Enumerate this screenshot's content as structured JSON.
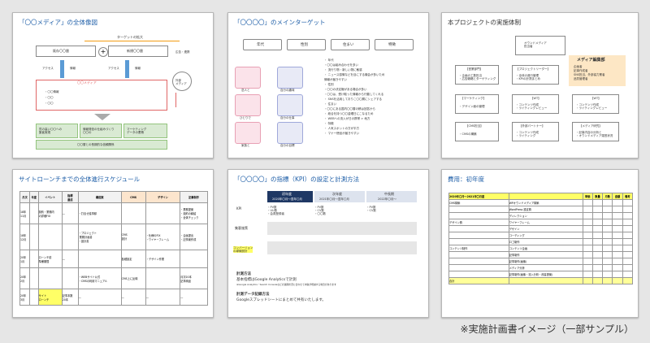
{
  "slides": {
    "s1": {
      "title": "「〇〇メディア」の全体像図",
      "target_expand": "ターゲットの拡大",
      "existing": "既存〇〇層",
      "new": "新規〇〇層",
      "access1": "アクセス",
      "access2": "アクセス",
      "info1": "情報",
      "info2": "情報",
      "ad": "広告・連携",
      "media": "〇〇メディア",
      "outside": "外部\nメディア",
      "bullets": [
        "・〇〇情報",
        "・〇〇",
        "・〇〇"
      ],
      "bottom": [
        "質の高い〇〇への\n集客実現",
        "情報発信の仕組みづくり\n〇〇の",
        "マーケティング\nデータの蓄積"
      ],
      "footer": "〇〇層との長期的な信頼関係"
    },
    "s2": {
      "title": "「〇〇〇〇」のメインターゲット",
      "tags": [
        "年代",
        "性別",
        "住まい",
        "特徴"
      ],
      "people": [
        "恋人と",
        "自分の趣味",
        "ひとりで",
        "自分の仕事",
        "家族と",
        "自分の目標"
      ],
      "notes": [
        "・ 年代",
        "・〇〇は組み合わせを多い",
        "・ 流行り物・新しい物に敏感",
        "・ ニュース感情などを目にする機会が多いため",
        "  情報が届きやすい",
        "・ 性別",
        "・〇〇の決定権がある場合が多い",
        "・〇〇は、受け取った情報から行動してくれる",
        "・ SNSを活用しておりこ〇〇層にシェアする",
        "・ 住まい",
        "・〇〇にある国内〇〇層の積は回答から",
        "・ 総合を持つ〇〇金曜日にこなるため",
        "・ WEBへの流入が日の携帯 > 地方",
        "・ 特徴",
        "・ 人気スポットの方が平方",
        "・ マナー徳品が届きやすい"
      ]
    },
    "s3": {
      "title": "本プロジェクトの実施体制",
      "top": "オウンドメディア\n担当者",
      "team": "メディア編集部",
      "team_items": [
        "企画者",
        "記事作成者",
        "SNS担当、外部協力業者",
        "品質管理者"
      ],
      "row1": [
        "【営業部門】",
        "【プロジェクトリーダー】",
        "【MAI】"
      ],
      "row2": [
        "【マーケティング】",
        "【WT】",
        "【WT】"
      ],
      "row3": [
        "【CMS担当】",
        "【外部パートナー】",
        "【メディア研究】"
      ],
      "row1_sub": [
        "・企画の工数担当\n・広告戦略とターゲティング",
        "・全体の進行管理\n・KPIの計測まとめ",
        "・記事の作成\n・SEOチェック"
      ],
      "row2_sub": [
        "・デザイン面の管理",
        "・コンテンツ作成\n・ライティングレビュー",
        "・コンテンツ作成\n・ライティングレビュー"
      ],
      "row3_sub": [
        "・CMSの構築",
        "・コンテンツ作成\n・ライティング",
        "・記事内容の分析と\n・オウンドメディア運営状況"
      ]
    },
    "s4": {
      "title": "サイトローンチまでの全体進行スケジュール",
      "header": [
        "月次",
        "年度",
        "イベント",
        "指標\n達成",
        "構成案",
        "CMS",
        "デザイン",
        "記事制作"
      ],
      "rows": [
        [
          "18年\n11月",
          "",
          "契約・業務内\nの詳細FIX",
          "—",
          "・打合せ議事録",
          "",
          "",
          "・業務提案\n・契約の締結\n・全体チェック"
        ],
        [
          "18年\n12月",
          "",
          "",
          "",
          "・プロジェクト\n 業務計画書\n・設計書",
          "CMS\n設計",
          "・仕様のFIX\n・ワイヤーフレーム",
          "・企画提出\n・記事案作成"
        ],
        [
          "20年\n1月",
          "",
          "ローンチ前\n準備期間",
          "—",
          "",
          "各種設定",
          "・デザイン作業",
          ""
        ],
        [
          "20年\n2月",
          "",
          "",
          "",
          "・WEBサイト公式\n・CMSの利用マニュアル",
          "CMS上に反映",
          "",
          "月次20本\n記事納品"
        ],
        [
          "20年\n3月",
          "",
          "サイト\nローンチ",
          "記事本数\n20本",
          "—",
          "—",
          "—",
          "—"
        ]
      ]
    },
    "s5": {
      "title": "「〇〇〇〇」の指標（KPI）の設定と計測方法",
      "phases": [
        "初年度",
        "次年度",
        "中長期"
      ],
      "phase_sub": [
        "2020年〇月〜翌年〇月",
        "2021年〇月〜翌年〇月",
        "2022年〇月〜"
      ],
      "row_labels": [
        "KPI",
        "集客施策",
        "コンバージョン\nの導線設計"
      ],
      "kpi": [
        "・PV数\n・UU数\n・会員登録者",
        "・PV数\n・CV数\n・〇〇数",
        "・PV数\n・CV数"
      ],
      "measure_title": "計測方法",
      "measure_text": "基本指標はGoogle Analyticsで計測",
      "measure_note": "※Google Analytics・Search Consoleなどの運用状況に合わせて内容が増減する場合があります",
      "report_title": "計測データ記録方法",
      "report_text": "Googleスプレッドシートにまとめて共有いたします。"
    },
    "s6": {
      "title": "費用：初年度",
      "header": [
        "2020年〇月〜2021年〇月度",
        "",
        "単価",
        "数量",
        "月数",
        "金額",
        "備考"
      ],
      "left_labels": [
        "CMS構築",
        "",
        "",
        "デザイン費",
        "",
        "",
        "",
        "コンテンツ制作",
        "",
        "",
        "",
        "",
        "合計"
      ],
      "items": [
        "WPオウンドメディア構築",
        "WordPress 設定費",
        "ディレクション",
        "ワイヤーフレーム",
        "デザイン",
        "コーディング",
        "ロゴ制作",
        "コンテンツ企画",
        "記事制作",
        "記事制作(画像)",
        "メディア分析",
        "記事制作(画像・流入分析・改善提案)",
        ""
      ]
    },
    "caption": "※実施計画書イメージ（一部サンプル）"
  }
}
